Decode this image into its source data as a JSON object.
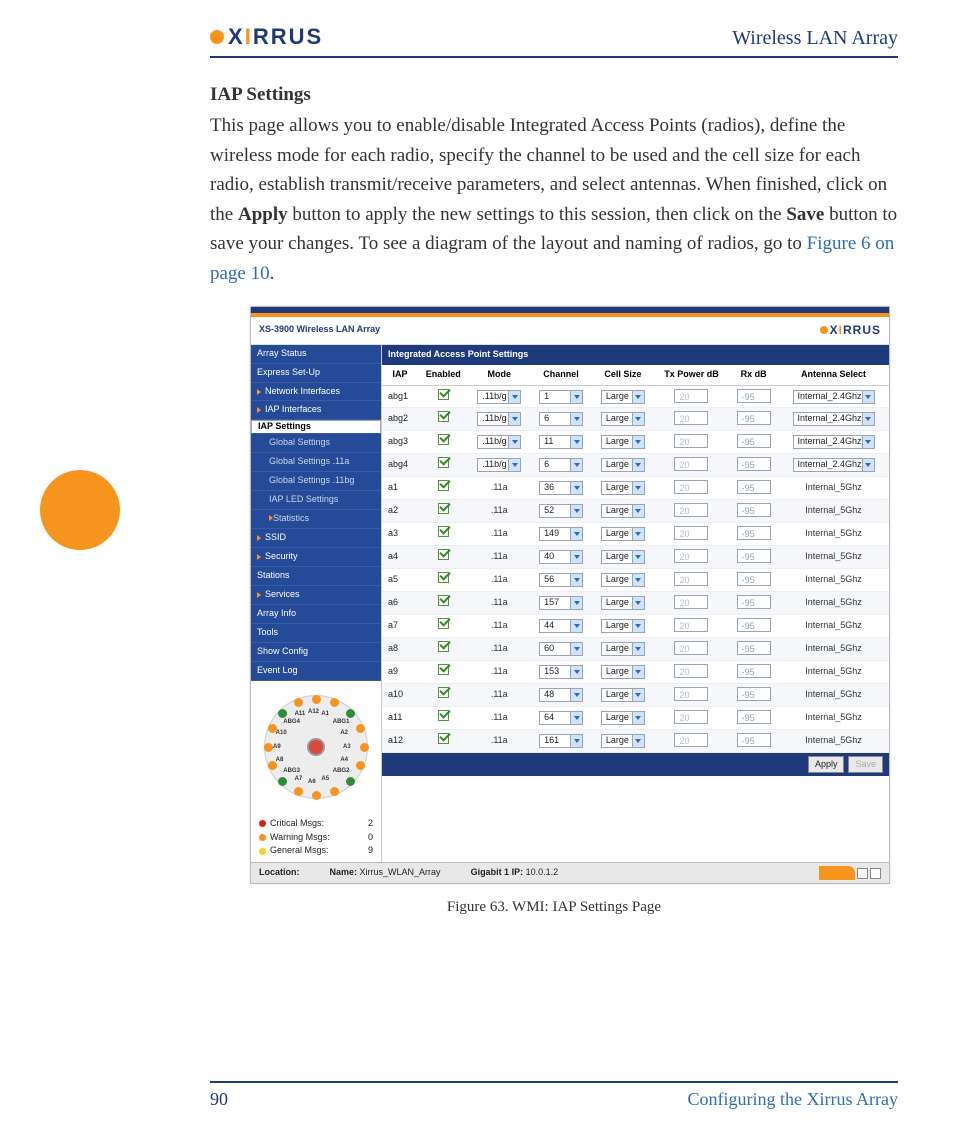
{
  "doc": {
    "brand_prefix": "X",
    "brand_i": "I",
    "brand_suffix": "RRUS",
    "title": "Wireless LAN Array",
    "page_number": "90",
    "footer_section": "Configuring the Xirrus Array"
  },
  "body": {
    "heading": "IAP Settings",
    "p1a": "This page allows you to enable/disable Integrated Access Points (radios), define the wireless mode for each radio, specify the channel to be used and the cell size for each radio, establish transmit/receive parameters, and select antennas. When finished, click on the ",
    "apply": "Apply",
    "p1b": " button to apply the new settings to this session, then click on the ",
    "save": "Save",
    "p1c": " button to save your changes. To see a diagram of the layout and naming of radios, go to ",
    "link": "Figure 6 on page 10",
    "p1d": ".",
    "caption": "Figure 63. WMI: IAP Settings Page"
  },
  "shot": {
    "window_title": "XS-3900 Wireless LAN Array",
    "panel_title": "Integrated Access Point Settings",
    "nav": [
      {
        "label": "Array Status",
        "type": "top"
      },
      {
        "label": "Express Set-Up",
        "type": "top"
      },
      {
        "label": "Network Interfaces",
        "type": "top",
        "arrow": true
      },
      {
        "label": "IAP Interfaces",
        "type": "top",
        "arrow": true,
        "expanded": true
      },
      {
        "label": "IAP Settings",
        "type": "sel"
      },
      {
        "label": "Global Settings",
        "type": "sub"
      },
      {
        "label": "Global Settings .11a",
        "type": "sub"
      },
      {
        "label": "Global Settings .11bg",
        "type": "sub"
      },
      {
        "label": "IAP LED Settings",
        "type": "sub"
      },
      {
        "label": "Statistics",
        "type": "sub",
        "arrow": true
      },
      {
        "label": "SSID",
        "type": "top",
        "arrow": true
      },
      {
        "label": "Security",
        "type": "top",
        "arrow": true
      },
      {
        "label": "Stations",
        "type": "top"
      },
      {
        "label": "Services",
        "type": "top",
        "arrow": true
      },
      {
        "label": "Array Info",
        "type": "top"
      },
      {
        "label": "Tools",
        "type": "top"
      },
      {
        "label": "Show Config",
        "type": "top"
      },
      {
        "label": "Event Log",
        "type": "top"
      }
    ],
    "diagram_labels": [
      "A12",
      "A1",
      "ABG1",
      "A2",
      "A3",
      "A4",
      "ABG2",
      "A5",
      "A6",
      "A7",
      "ABG3",
      "A8",
      "A9",
      "A10",
      "ABG4",
      "A11"
    ],
    "msgs": {
      "critical_label": "Critical Msgs:",
      "critical_val": "2",
      "warning_label": "Warning Msgs:",
      "warning_val": "0",
      "general_label": "General Msgs:",
      "general_val": "9"
    },
    "headers": [
      "IAP",
      "Enabled",
      "Mode",
      "Channel",
      "Cell Size",
      "Tx Power dB",
      "Rx dB",
      "Antenna Select"
    ],
    "rows": [
      {
        "iap": "abg1",
        "enabled": true,
        "mode": ".11b/g",
        "mode_sel": true,
        "channel": "1",
        "cell": "Large",
        "tx": "20",
        "rx": "-95",
        "ant": "Internal_2.4Ghz",
        "ant_sel": true
      },
      {
        "iap": "abg2",
        "enabled": true,
        "mode": ".11b/g",
        "mode_sel": true,
        "channel": "6",
        "cell": "Large",
        "tx": "20",
        "rx": "-95",
        "ant": "Internal_2.4Ghz",
        "ant_sel": true
      },
      {
        "iap": "abg3",
        "enabled": true,
        "mode": ".11b/g",
        "mode_sel": true,
        "channel": "11",
        "cell": "Large",
        "tx": "20",
        "rx": "-95",
        "ant": "Internal_2.4Ghz",
        "ant_sel": true
      },
      {
        "iap": "abg4",
        "enabled": true,
        "mode": ".11b/g",
        "mode_sel": true,
        "channel": "6",
        "cell": "Large",
        "tx": "20",
        "rx": "-95",
        "ant": "Internal_2.4Ghz",
        "ant_sel": true
      },
      {
        "iap": "a1",
        "enabled": true,
        "mode": ".11a",
        "mode_sel": false,
        "channel": "36",
        "cell": "Large",
        "tx": "20",
        "rx": "-95",
        "ant": "Internal_5Ghz",
        "ant_sel": false
      },
      {
        "iap": "a2",
        "enabled": true,
        "mode": ".11a",
        "mode_sel": false,
        "channel": "52",
        "cell": "Large",
        "tx": "20",
        "rx": "-95",
        "ant": "Internal_5Ghz",
        "ant_sel": false
      },
      {
        "iap": "a3",
        "enabled": true,
        "mode": ".11a",
        "mode_sel": false,
        "channel": "149",
        "cell": "Large",
        "tx": "20",
        "rx": "-95",
        "ant": "Internal_5Ghz",
        "ant_sel": false
      },
      {
        "iap": "a4",
        "enabled": true,
        "mode": ".11a",
        "mode_sel": false,
        "channel": "40",
        "cell": "Large",
        "tx": "20",
        "rx": "-95",
        "ant": "Internal_5Ghz",
        "ant_sel": false
      },
      {
        "iap": "a5",
        "enabled": true,
        "mode": ".11a",
        "mode_sel": false,
        "channel": "56",
        "cell": "Large",
        "tx": "20",
        "rx": "-95",
        "ant": "Internal_5Ghz",
        "ant_sel": false
      },
      {
        "iap": "a6",
        "enabled": true,
        "mode": ".11a",
        "mode_sel": false,
        "channel": "157",
        "cell": "Large",
        "tx": "20",
        "rx": "-95",
        "ant": "Internal_5Ghz",
        "ant_sel": false
      },
      {
        "iap": "a7",
        "enabled": true,
        "mode": ".11a",
        "mode_sel": false,
        "channel": "44",
        "cell": "Large",
        "tx": "20",
        "rx": "-95",
        "ant": "Internal_5Ghz",
        "ant_sel": false
      },
      {
        "iap": "a8",
        "enabled": true,
        "mode": ".11a",
        "mode_sel": false,
        "channel": "60",
        "cell": "Large",
        "tx": "20",
        "rx": "-95",
        "ant": "Internal_5Ghz",
        "ant_sel": false
      },
      {
        "iap": "a9",
        "enabled": true,
        "mode": ".11a",
        "mode_sel": false,
        "channel": "153",
        "cell": "Large",
        "tx": "20",
        "rx": "-95",
        "ant": "Internal_5Ghz",
        "ant_sel": false
      },
      {
        "iap": "a10",
        "enabled": true,
        "mode": ".11a",
        "mode_sel": false,
        "channel": "48",
        "cell": "Large",
        "tx": "20",
        "rx": "-95",
        "ant": "Internal_5Ghz",
        "ant_sel": false
      },
      {
        "iap": "a11",
        "enabled": true,
        "mode": ".11a",
        "mode_sel": false,
        "channel": "64",
        "cell": "Large",
        "tx": "20",
        "rx": "-95",
        "ant": "Internal_5Ghz",
        "ant_sel": false
      },
      {
        "iap": "a12",
        "enabled": true,
        "mode": ".11a",
        "mode_sel": false,
        "channel": "161",
        "cell": "Large",
        "tx": "20",
        "rx": "-95",
        "ant": "Internal_5Ghz",
        "ant_sel": false
      }
    ],
    "apply_btn": "Apply",
    "save_btn": "Save",
    "status": {
      "location_label": "Location:",
      "name_label": "Name:",
      "name_value": "Xirrus_WLAN_Array",
      "gig_label": "Gigabit 1 IP:",
      "gig_value": "10.0.1.2"
    }
  }
}
